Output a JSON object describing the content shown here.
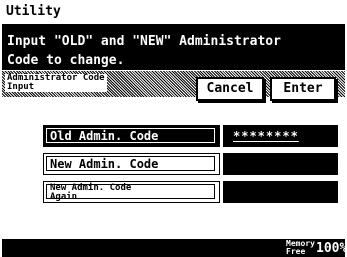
{
  "title": "Utility",
  "message": {
    "line1": "Input \"OLD\" and \"NEW\" Administrator",
    "line2": "Code to change."
  },
  "section": {
    "label_line1": "Administrator Code",
    "label_line2": "Input"
  },
  "buttons": {
    "cancel": "Cancel",
    "enter": "Enter"
  },
  "fields": [
    {
      "label": "Old Admin. Code",
      "value": "********",
      "active": true
    },
    {
      "label": "New Admin. Code",
      "value": ""
    },
    {
      "label_line1": "New Admin. Code",
      "label_line2": "Again",
      "value": ""
    }
  ],
  "footer": {
    "memory_label_line1": "Memory",
    "memory_label_line2": "Free",
    "memory_value": "100%"
  }
}
